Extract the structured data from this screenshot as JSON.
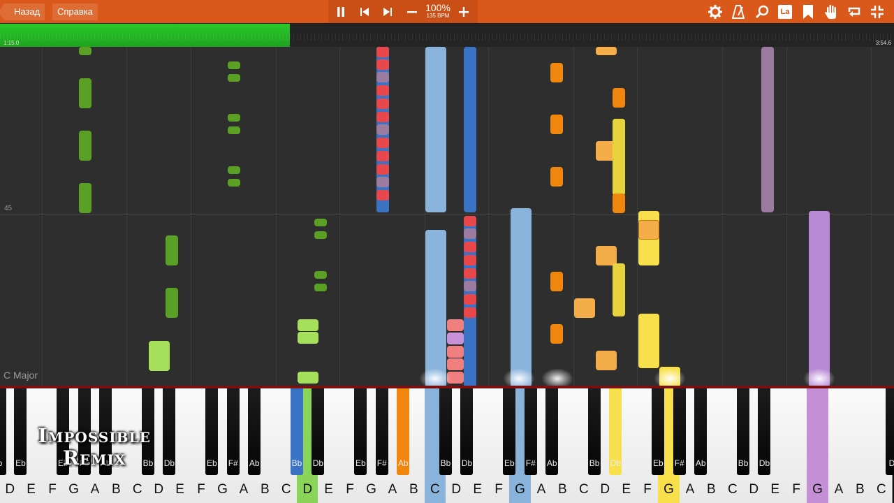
{
  "toolbar": {
    "back_label": "Назад",
    "help_label": "Справка",
    "speed_percent": "100%",
    "speed_bpm": "135 BPM",
    "icons": [
      "pause-icon",
      "skip-back-icon",
      "skip-forward-icon",
      "minus-icon",
      "plus-icon",
      "settings-icon",
      "metronome-icon",
      "magnifier-icon",
      "label-la-icon",
      "bookmark-icon",
      "hand-icon",
      "loop-icon",
      "collapse-icon"
    ],
    "la_label": "La"
  },
  "progress": {
    "fraction": 0.324,
    "current_time": "1:15.0",
    "total_time": "3:54.6"
  },
  "roll": {
    "measure_number": "45",
    "key_signature": "C Major"
  },
  "colors": {
    "toolbar": "#d9581a",
    "progress": "#22b822",
    "green_track": "#5aa024",
    "light_green_track": "#a6e05a",
    "red_track": "#e8474b",
    "light_blue_track": "#89b3db",
    "blue_track": "#3a73c4",
    "orange_track": "#f0860e",
    "light_orange_track": "#f5ad4a",
    "yellow_track": "#f8e04c",
    "purple_track": "#b889d4"
  },
  "keyboard": {
    "white_keys": [
      "D",
      "E",
      "F",
      "G",
      "A",
      "B",
      "C",
      "D",
      "E",
      "F",
      "G",
      "A",
      "B",
      "C",
      "D",
      "E",
      "F",
      "G",
      "A",
      "B",
      "C",
      "D",
      "E",
      "F",
      "G",
      "A",
      "B",
      "C",
      "D",
      "E",
      "F",
      "G",
      "A",
      "B",
      "C",
      "D",
      "E",
      "F",
      "G",
      "A",
      "B",
      "C"
    ],
    "black_keys": [
      "Eb",
      "Eb",
      "F#",
      "Ab",
      "Bb",
      "Db",
      "Eb",
      "F#",
      "Ab",
      "Bb",
      "Db",
      "Eb",
      "F#",
      "Ab",
      "Bb",
      "Db",
      "Eb",
      "F#",
      "Ab",
      "Bb",
      "Db",
      "Eb",
      "F#",
      "Ab",
      "Bb",
      "Db"
    ],
    "first_black_label": "b",
    "last_black_label": "D"
  },
  "watermark": {
    "line1": "Impossible",
    "line2": "Remix"
  }
}
